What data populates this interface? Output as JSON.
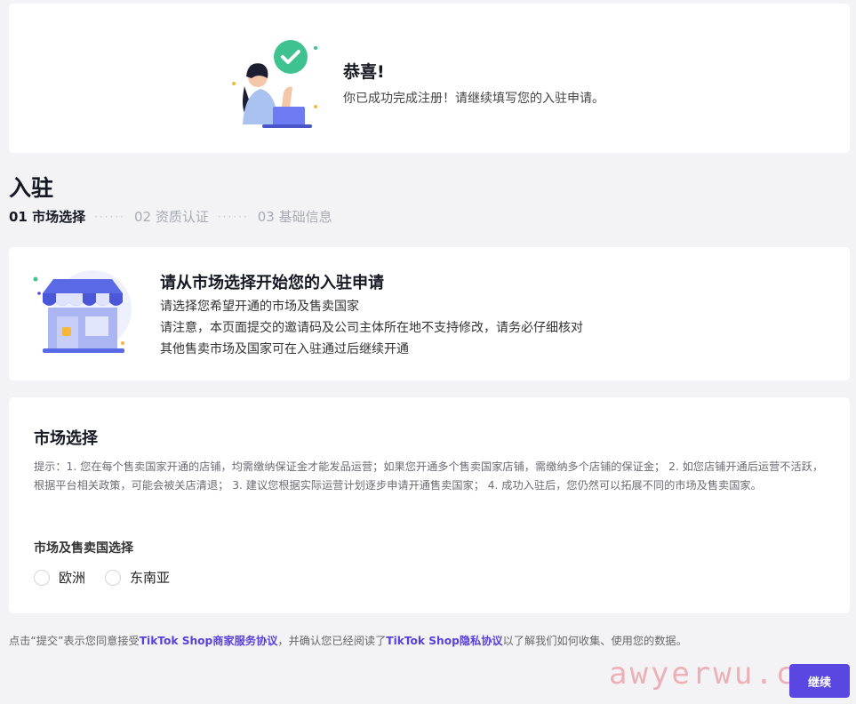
{
  "success": {
    "title": "恭喜!",
    "description": "你已成功完成注册！请继续填写您的入驻申请。"
  },
  "page": {
    "title": "入驻"
  },
  "steps": [
    {
      "label": "01 市场选择",
      "active": true
    },
    {
      "label": "02 资质认证",
      "active": false
    },
    {
      "label": "03 基础信息",
      "active": false
    }
  ],
  "step_separator": "······",
  "intro": {
    "title": "请从市场选择开始您的入驻申请",
    "lines": [
      "请选择您希望开通的市场及售卖国家",
      "请注意，本页面提交的邀请码及公司主体所在地不支持修改，请务必仔细核对",
      "其他售卖市场及国家可在入驻通过后继续开通"
    ]
  },
  "market": {
    "title": "市场选择",
    "tip": "提示：1. 您在每个售卖国家开通的店铺，均需缴纳保证金才能发品运营；如果您开通多个售卖国家店铺，需缴纳多个店铺的保证金； 2. 如您店铺开通后运营不活跃，根据平台相关政策，可能会被关店清退； 3. 建议您根据实际运营计划逐步申请开通售卖国家； 4. 成功入驻后，您仍然可以拓展不同的市场及售卖国家。",
    "region_label": "市场及售卖国选择",
    "options": [
      {
        "label": "欧洲",
        "selected": false
      },
      {
        "label": "东南亚",
        "selected": false
      }
    ]
  },
  "agreement": {
    "prefix": "点击“提交”表示您同意接受",
    "link1": "TikTok Shop商家服务协议",
    "middle": "，并确认您已经阅读了",
    "link2": "TikTok Shop隐私协议",
    "suffix": "以了解我们如何收集、使用您的数据。"
  },
  "continue_label": "继续",
  "watermark": "awyerwu.com",
  "colors": {
    "accent": "#5a46e0",
    "link": "#5b3fd9",
    "success_green": "#3ec28f",
    "background": "#f3f3f6"
  }
}
